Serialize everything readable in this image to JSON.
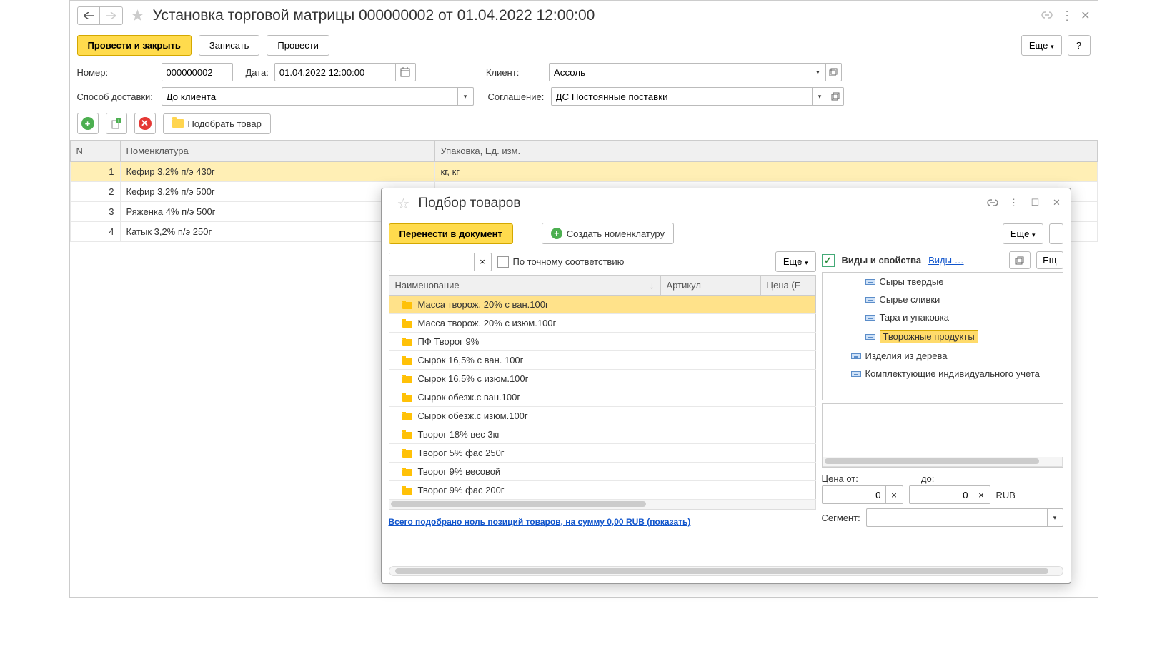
{
  "header": {
    "title": "Установка торговой матрицы 000000002 от 01.04.2022 12:00:00"
  },
  "toolbar": {
    "post_close": "Провести и закрыть",
    "write": "Записать",
    "post": "Провести",
    "more": "Еще",
    "help": "?"
  },
  "form": {
    "number_label": "Номер:",
    "number": "000000002",
    "date_label": "Дата:",
    "date": "01.04.2022 12:00:00",
    "client_label": "Клиент:",
    "client": "Ассоль",
    "delivery_label": "Способ доставки:",
    "delivery": "До клиента",
    "agreement_label": "Соглашение:",
    "agreement": "ДС Постоянные поставки",
    "pick_goods": "Подобрать товар"
  },
  "main_table": {
    "cols": {
      "n": "N",
      "nom": "Номенклатура",
      "pack": "Упаковка, Ед. изм."
    },
    "rows": [
      {
        "n": "1",
        "nom": "Кефир 3,2%  п/э 430г",
        "pack": "кг, кг",
        "selected": true
      },
      {
        "n": "2",
        "nom": "Кефир 3,2%  п/э 500г",
        "pack": ""
      },
      {
        "n": "3",
        "nom": "Ряженка 4% п/э 500г",
        "pack": ""
      },
      {
        "n": "4",
        "nom": "Катык  3,2%  п/э 250г",
        "pack": ""
      }
    ]
  },
  "dialog": {
    "title": "Подбор товаров",
    "transfer": "Перенести в документ",
    "create_nom": "Создать номенклатуру",
    "more": "Еще",
    "exact_match": "По точному соответствию",
    "list_cols": {
      "name": "Наименование",
      "article": "Артикул",
      "price": "Цена (F"
    },
    "list": [
      {
        "name": "Масса творож. 20% с ван.100г",
        "selected": true
      },
      {
        "name": "Масса творож. 20% с изюм.100г"
      },
      {
        "name": "ПФ Творог 9%"
      },
      {
        "name": "Сырок  16,5% с ван. 100г"
      },
      {
        "name": "Сырок  16,5% с изюм.100г"
      },
      {
        "name": "Сырок  обезж.с ван.100г"
      },
      {
        "name": "Сырок  обезж.с изюм.100г"
      },
      {
        "name": "Творог 18% вес 3кг"
      },
      {
        "name": "Творог 5% фас 250г"
      },
      {
        "name": "Творог 9% весовой"
      },
      {
        "name": "Творог 9% фас 200г"
      }
    ],
    "summary": "Всего подобрано ноль позиций товаров, на сумму 0,00 RUB (показать)",
    "types_title": "Виды и свойства",
    "types_link": "Виды …",
    "tree": [
      {
        "label": "Сыры твердые",
        "level": 3
      },
      {
        "label": "Сырье сливки",
        "level": 3
      },
      {
        "label": "Тара и упаковка",
        "level": 3
      },
      {
        "label": "Творожные продукты",
        "level": 3,
        "selected": true
      },
      {
        "label": "Изделия из дерева",
        "level": 2
      },
      {
        "label": "Комплектующие индивидуального учета",
        "level": 2
      }
    ],
    "price_from_label": "Цена от:",
    "price_to_label": "до:",
    "price_from": "0",
    "price_to": "0",
    "currency": "RUB",
    "segment_label": "Сегмент:"
  }
}
